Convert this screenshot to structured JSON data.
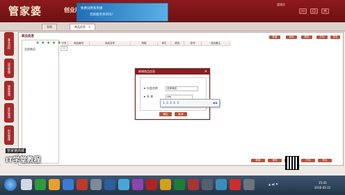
{
  "header": {
    "logo": "管家婆",
    "edition": "创业版",
    "banner_line1": "免费试用系列课",
    "banner_line2": "贷款服务贵的吗?",
    "user": "管理员",
    "window_controls": [
      "—",
      "▢",
      "✕"
    ]
  },
  "tabs": [
    {
      "label": "导航"
    },
    {
      "label": "商品信息",
      "close": "✕"
    }
  ],
  "left_tabs": [
    "基本资料",
    "进货管理",
    "销售管理",
    "库存管理",
    "财务管理"
  ],
  "panel": {
    "title": "商品信息",
    "top_buttons": [
      "新增",
      "修改",
      "删除",
      "打印",
      "导出Excel"
    ],
    "tree_tools": "✚ ✚ ✚ ✚ ✚",
    "tree_root": "全部商品"
  },
  "grid": {
    "headers": [
      "行号",
      "商品编号",
      "商品名称",
      "规格",
      "单位",
      "颜色",
      "型号",
      "商品备注"
    ],
    "row_index": "1"
  },
  "bottom_buttons": [
    "新增",
    "修改",
    "删除",
    "打印",
    "导出"
  ],
  "dialog": {
    "title": "新增商品信息",
    "close": "✕",
    "name_label": "★ 分类名称",
    "name_value": "全部商品",
    "code_label": "★ 名 称",
    "code_value": "sbq",
    "ok": "确定",
    "cancel": "取消"
  },
  "ime": {
    "candidates": "1.  2.  3.  4.  5.",
    "arrows": "◀ ▶"
  },
  "watermark": {
    "line1": "管家婆商城",
    "line2": "IT学堂教程"
  },
  "taskbar": {
    "tray": "▲  ◀)  ⚑",
    "time": "15:43",
    "date": "2016-03-31"
  }
}
